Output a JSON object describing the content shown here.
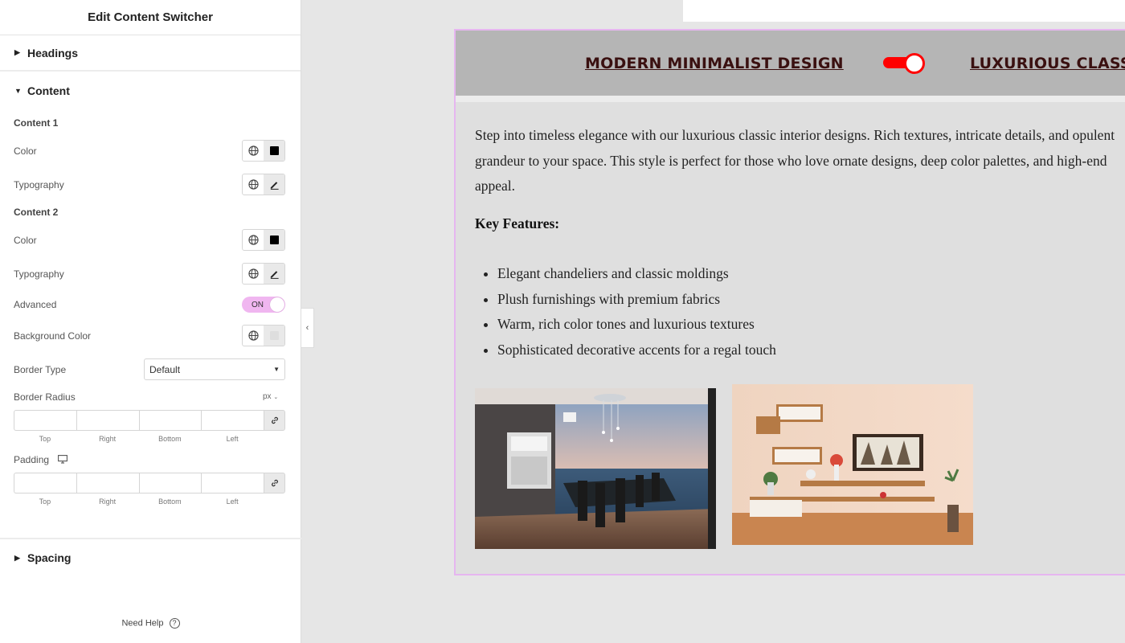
{
  "panel": {
    "title": "Edit Content Switcher",
    "sections": {
      "headings": "Headings",
      "content": "Content",
      "spacing": "Spacing"
    },
    "content1": {
      "title": "Content 1",
      "color_label": "Color",
      "typography_label": "Typography"
    },
    "content2": {
      "title": "Content 2",
      "color_label": "Color",
      "typography_label": "Typography"
    },
    "advanced": {
      "label": "Advanced",
      "toggle_text": "ON"
    },
    "background_color_label": "Background Color",
    "border_type": {
      "label": "Border Type",
      "value": "Default"
    },
    "border_radius": {
      "label": "Border Radius",
      "unit": "px"
    },
    "padding": {
      "label": "Padding"
    },
    "dim_labels": [
      "Top",
      "Right",
      "Bottom",
      "Left"
    ],
    "need_help": "Need Help",
    "accent_color": "#f0b6f0"
  },
  "switcher": {
    "left_label": "MODERN MINIMALIST DESIGN",
    "right_label": "LUXURIOUS CLASSIC",
    "toggle_color": "#ff0000",
    "body": "Step into timeless elegance with our luxurious classic interior designs. Rich textures, intricate details, and opulent grandeur to your space. This style is perfect for those who love ornate designs, deep color palettes, and high-end appeal.",
    "key_features_title": "Key Features:",
    "features": [
      "Elegant chandeliers and classic moldings",
      "Plush furnishings with premium fabrics",
      "Warm, rich color tones and luxurious textures",
      "Sophisticated decorative accents for a regal touch"
    ]
  }
}
